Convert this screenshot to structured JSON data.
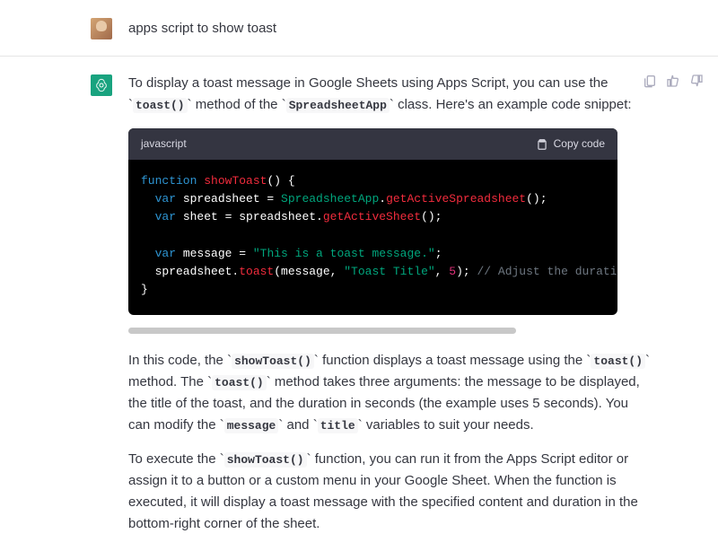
{
  "user": {
    "prompt": "apps script to show toast"
  },
  "assistant": {
    "p1_a": "To display a toast message in Google Sheets using Apps Script, you can use the ",
    "p1_code1": "toast()",
    "p1_b": " method of the ",
    "p1_code2": "SpreadsheetApp",
    "p1_c": " class. Here's an example code snippet:",
    "code": {
      "lang": "javascript",
      "copy_label": "Copy code",
      "t": {
        "function": "function",
        "showToast": "showToast",
        "paren_open_brace": "() {",
        "var1": "var",
        "spreadsheet_eq": " spreadsheet = ",
        "SpreadsheetApp": "SpreadsheetApp",
        "dot1": ".",
        "getActiveSpreadsheet": "getActiveSpreadsheet",
        "call_semi": "();",
        "var2": "var",
        "sheet_eq": " sheet = spreadsheet.",
        "getActiveSheet": "getActiveSheet",
        "call_semi2": "();",
        "var3": "var",
        "message_eq": " message = ",
        "msg_str": "\"This is a toast message.\"",
        "semi": ";",
        "spreadsheet_dot": "  spreadsheet.",
        "toast": "toast",
        "open_args": "(message, ",
        "title_str": "\"Toast Title\"",
        "comma_sp": ", ",
        "five": "5",
        "close_args": "); ",
        "comment": "// Adjust the duration as needed",
        "close_brace": "}"
      }
    },
    "p2_a": "In this code, the ",
    "p2_code1": "showToast()",
    "p2_b": " function displays a toast message using the ",
    "p2_code2": "toast()",
    "p2_c": " method. The ",
    "p2_code3": "toast()",
    "p2_d": " method takes three arguments: the message to be displayed, the title of the toast, and the duration in seconds (the example uses 5 seconds). You can modify the ",
    "p2_code4": "message",
    "p2_e": " and ",
    "p2_code5": "title",
    "p2_f": " variables to suit your needs.",
    "p3_a": "To execute the ",
    "p3_code1": "showToast()",
    "p3_b": " function, you can run it from the Apps Script editor or assign it to a button or a custom menu in your Google Sheet. When the function is executed, it will display a toast message with the specified content and duration in the bottom-right corner of the sheet."
  }
}
